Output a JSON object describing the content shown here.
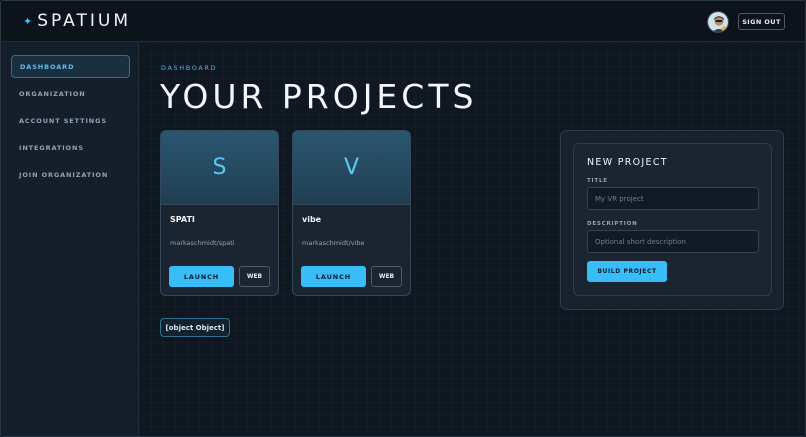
{
  "app": {
    "name": "SPATIUM"
  },
  "header": {
    "signout_label": "SIGN OUT"
  },
  "sidebar": {
    "items": [
      {
        "label": "DASHBOARD",
        "active": true
      },
      {
        "label": "ORGANIZATION"
      },
      {
        "label": "ACCOUNT SETTINGS"
      },
      {
        "label": "INTEGRATIONS"
      },
      {
        "label": "JOIN ORGANIZATION"
      }
    ]
  },
  "main": {
    "breadcrumb": "DASHBOARD",
    "title": "YOUR PROJECTS",
    "projects": [
      {
        "letter": "S",
        "name": "SPATI",
        "path": "markaschmidt/spati",
        "launch_label": "LAUNCH",
        "web_label": "WEB"
      },
      {
        "letter": "V",
        "name": "vibe",
        "path": "markaschmidt/vibe",
        "launch_label": "LAUNCH",
        "web_label": "WEB"
      }
    ],
    "object_chip": "[object Object]"
  },
  "new_project": {
    "heading": "NEW PROJECT",
    "title_label": "TITLE",
    "title_placeholder": "My VR project",
    "title_value": "",
    "description_label": "DESCRIPTION",
    "description_placeholder": "Optional short description",
    "description_value": "",
    "build_label": "BUILD PROJECT"
  },
  "colors": {
    "accent": "#38bdf8",
    "background": "#0f1721",
    "sidebar": "#151f2b"
  }
}
